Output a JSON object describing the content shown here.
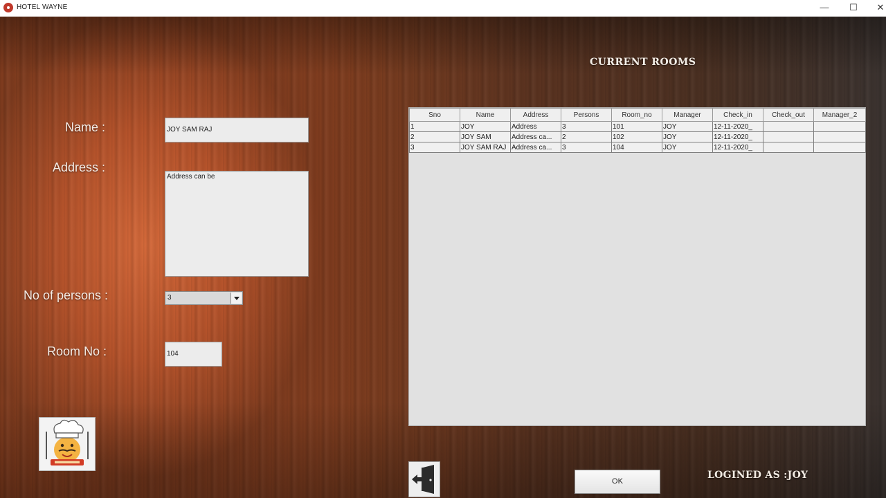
{
  "window": {
    "title": "HOTEL WAYNE",
    "minimize": "—",
    "maximize": "☐",
    "close": "✕"
  },
  "form": {
    "name_label": "Name :",
    "name_value": "JOY SAM RAJ",
    "address_label": "Address :",
    "address_value": "Address can be",
    "persons_label": "No of persons :",
    "persons_value": "3",
    "room_label": "Room No :",
    "room_value": "104"
  },
  "rooms": {
    "title": "CURRENT ROOMS",
    "columns": [
      "Sno",
      "Name",
      "Address",
      "Persons",
      "Room_no",
      "Manager",
      "Check_in",
      "Check_out",
      "Manager_2"
    ],
    "rows": [
      [
        "1",
        "JOY",
        "Address",
        "3",
        "101",
        "JOY",
        "12-11-2020_",
        "",
        ""
      ],
      [
        "2",
        "JOY SAM",
        "Address ca...",
        "2",
        "102",
        "JOY",
        "12-11-2020_",
        "",
        ""
      ],
      [
        "3",
        "JOY SAM RAJ",
        "Address ca...",
        "3",
        "104",
        "JOY",
        "12-11-2020_",
        "",
        ""
      ]
    ]
  },
  "actions": {
    "ok_label": "OK"
  },
  "status": {
    "login_text": "LOGINED AS :JOY"
  },
  "colors": {
    "accent_red": "#c0392b",
    "wood_light": "#d4693a",
    "wood_dark": "#3b3330"
  }
}
